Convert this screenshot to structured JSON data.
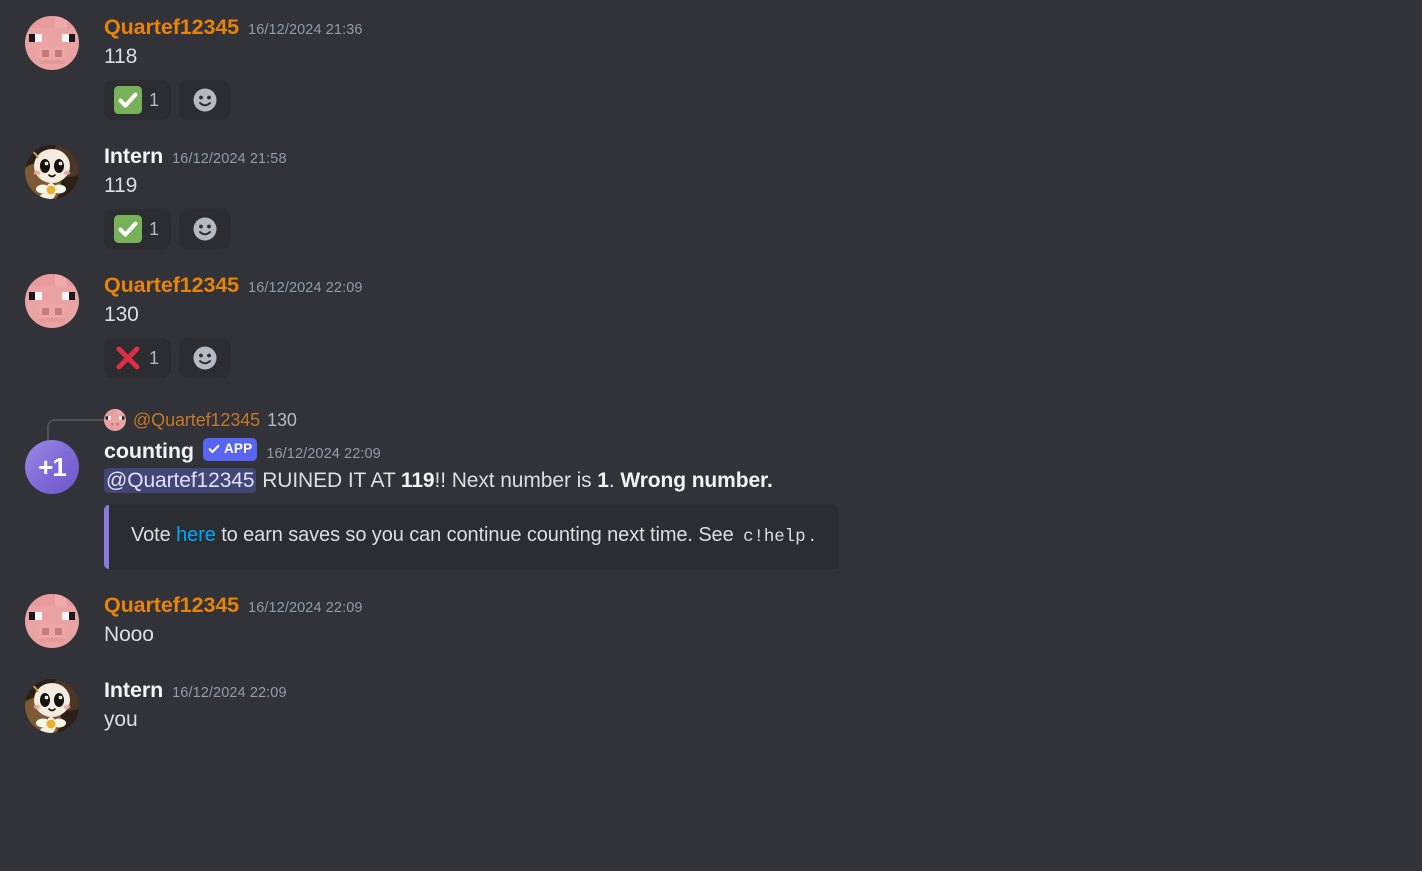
{
  "app": {
    "name": "Discord",
    "theme_bg": "#313338",
    "accent": "#5865f2"
  },
  "colors": {
    "username_orange": "#e8820c",
    "embed_bar_purple": "#8d7ae0",
    "mention_bg": "#414675",
    "link_blue": "#00a8fc",
    "reaction_bg": "#2b2d31"
  },
  "messages": [
    {
      "id": "m1",
      "author": "Quartef12345",
      "author_color": "orange",
      "timestamp": "16/12/2024 21:36",
      "avatar": "minecraft-pig-avatar",
      "text": "118",
      "reactions": [
        {
          "emoji": "white-check-mark",
          "count": "1"
        }
      ],
      "add_reaction": "add-reaction-icon"
    },
    {
      "id": "m2",
      "author": "Intern",
      "author_color": "white",
      "timestamp": "16/12/2024 21:58",
      "avatar": "cartoon-flower-avatar",
      "text": "119",
      "reactions": [
        {
          "emoji": "white-check-mark",
          "count": "1"
        }
      ],
      "add_reaction": "add-reaction-icon"
    },
    {
      "id": "m3",
      "author": "Quartef12345",
      "author_color": "orange",
      "timestamp": "16/12/2024 22:09",
      "avatar": "minecraft-pig-avatar",
      "text": "130",
      "reactions": [
        {
          "emoji": "cross-mark",
          "count": "1"
        }
      ],
      "add_reaction": "add-reaction-icon"
    },
    {
      "id": "m4",
      "author": "counting",
      "author_color": "white",
      "is_bot": true,
      "badge": "APP",
      "timestamp": "16/12/2024 22:09",
      "avatar": "plus-one-bot-avatar",
      "avatar_text": "+1",
      "reply": {
        "avatar": "minecraft-pig-avatar",
        "mention": "@Quartef12345",
        "preview_text": "130"
      },
      "rich_text": {
        "mention": "@Quartef12345",
        "part1": " RUINED IT AT ",
        "bold1": "119",
        "part2": "!! Next number is ",
        "bold2": "1",
        "part3": ". ",
        "bold3": "Wrong number."
      },
      "embed": {
        "bar_color": "#8d7ae0",
        "desc_part1": "Vote ",
        "link_text": "here",
        "desc_part2": " to earn saves so you can continue counting next time. See ",
        "code": "c!help",
        "desc_part3": "."
      }
    },
    {
      "id": "m5",
      "author": "Quartef12345",
      "author_color": "orange",
      "timestamp": "16/12/2024 22:09",
      "avatar": "minecraft-pig-avatar",
      "text": "Nooo"
    },
    {
      "id": "m6",
      "author": "Intern",
      "author_color": "white",
      "timestamp": "16/12/2024 22:09",
      "avatar": "cartoon-flower-avatar",
      "text": "you"
    }
  ]
}
